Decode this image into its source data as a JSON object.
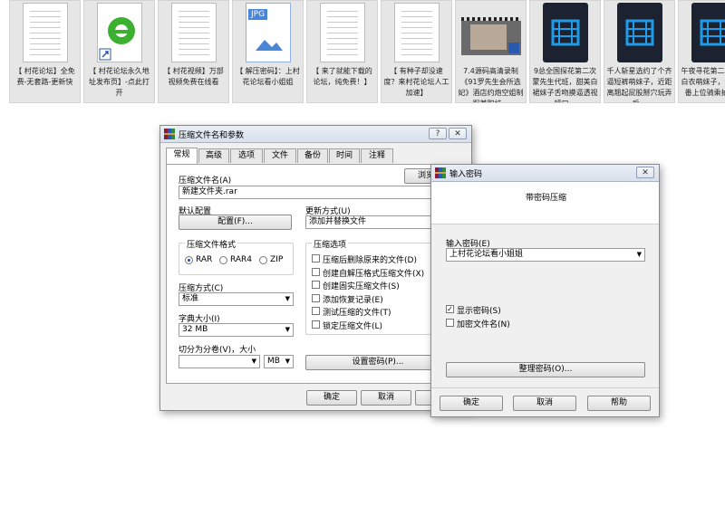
{
  "desktop": {
    "files": [
      {
        "kind": "doc",
        "label": "【 村花论坛】全免费-无套路-更新快"
      },
      {
        "kind": "ie",
        "label": "【 村花论坛永久地址发布页】-点此打开"
      },
      {
        "kind": "doc",
        "label": "【 村花视频】万部视频免费在线看"
      },
      {
        "kind": "jpg",
        "label": "【 解压密码】：上村花论坛看小姐姐",
        "badge": "JPG"
      },
      {
        "kind": "doc",
        "label": "【 来了就能下载的论坛，纯免费！】"
      },
      {
        "kind": "doc",
        "label": "【 有种子却没速度？来村花论坛人工加速】"
      },
      {
        "kind": "video-thumb",
        "label": "7.4源码高清录制《91罗先生会所选妃》酒店约炮空姐制服兼职妹..."
      },
      {
        "kind": "video",
        "label": "9总全国探花第二次蒙先生代班，甜美白裙妹子舌吻摸逼透视镜口..."
      },
      {
        "kind": "video",
        "label": "千人斩星选约了个齐逼短裤萌妹子，近距离翘起屁股掰穴玩弄后..."
      },
      {
        "kind": "video",
        "label": "午夜寻花第二场甜美白衣萌妹子，调情一番上位骑乘抽插..."
      }
    ]
  },
  "archive_dialog": {
    "title": "压缩文件名和参数",
    "help_btn": "?",
    "close_btn": "✕",
    "tabs": [
      "常规",
      "高级",
      "选项",
      "文件",
      "备份",
      "时间",
      "注释"
    ],
    "archive_name_label": "压缩文件名(A)",
    "archive_name_value": "新建文件夹.rar",
    "browse_btn": "浏览(",
    "default_config_label": "默认配置",
    "config_btn": "配置(F)...",
    "update_mode_label": "更新方式(U)",
    "update_mode_value": "添加并替换文件",
    "format_group_label": "压缩文件格式",
    "formats": [
      "RAR",
      "RAR4",
      "ZIP"
    ],
    "selected_format": "RAR",
    "options_group_label": "压缩选项",
    "options": [
      {
        "label": "压缩后删除原来的文件(D)",
        "checked": false
      },
      {
        "label": "创建自解压格式压缩文件(X)",
        "checked": false
      },
      {
        "label": "创建固实压缩文件(S)",
        "checked": false
      },
      {
        "label": "添加恢复记录(E)",
        "checked": false
      },
      {
        "label": "测试压缩的文件(T)",
        "checked": false
      },
      {
        "label": "锁定压缩文件(L)",
        "checked": false
      }
    ],
    "method_label": "压缩方式(C)",
    "method_value": "标准",
    "dict_label": "字典大小(I)",
    "dict_value": "32 MB",
    "split_label": "切分为分卷(V)，大小",
    "split_value": "",
    "split_unit": "MB",
    "set_password_btn": "设置密码(P)...",
    "ok_btn": "确定",
    "cancel_btn": "取消"
  },
  "password_dialog": {
    "title": "输入密码",
    "close_btn": "✕",
    "heading": "带密码压缩",
    "enter_password_label": "输入密码(E)",
    "password_value": "上村花论坛看小姐姐",
    "show_password_label": "显示密码(S)",
    "show_password_checked": true,
    "encrypt_names_label": "加密文件名(N)",
    "encrypt_names_checked": false,
    "organize_btn": "整理密码(O)...",
    "ok_btn": "确定",
    "cancel_btn": "取消",
    "help_btn": "帮助"
  }
}
